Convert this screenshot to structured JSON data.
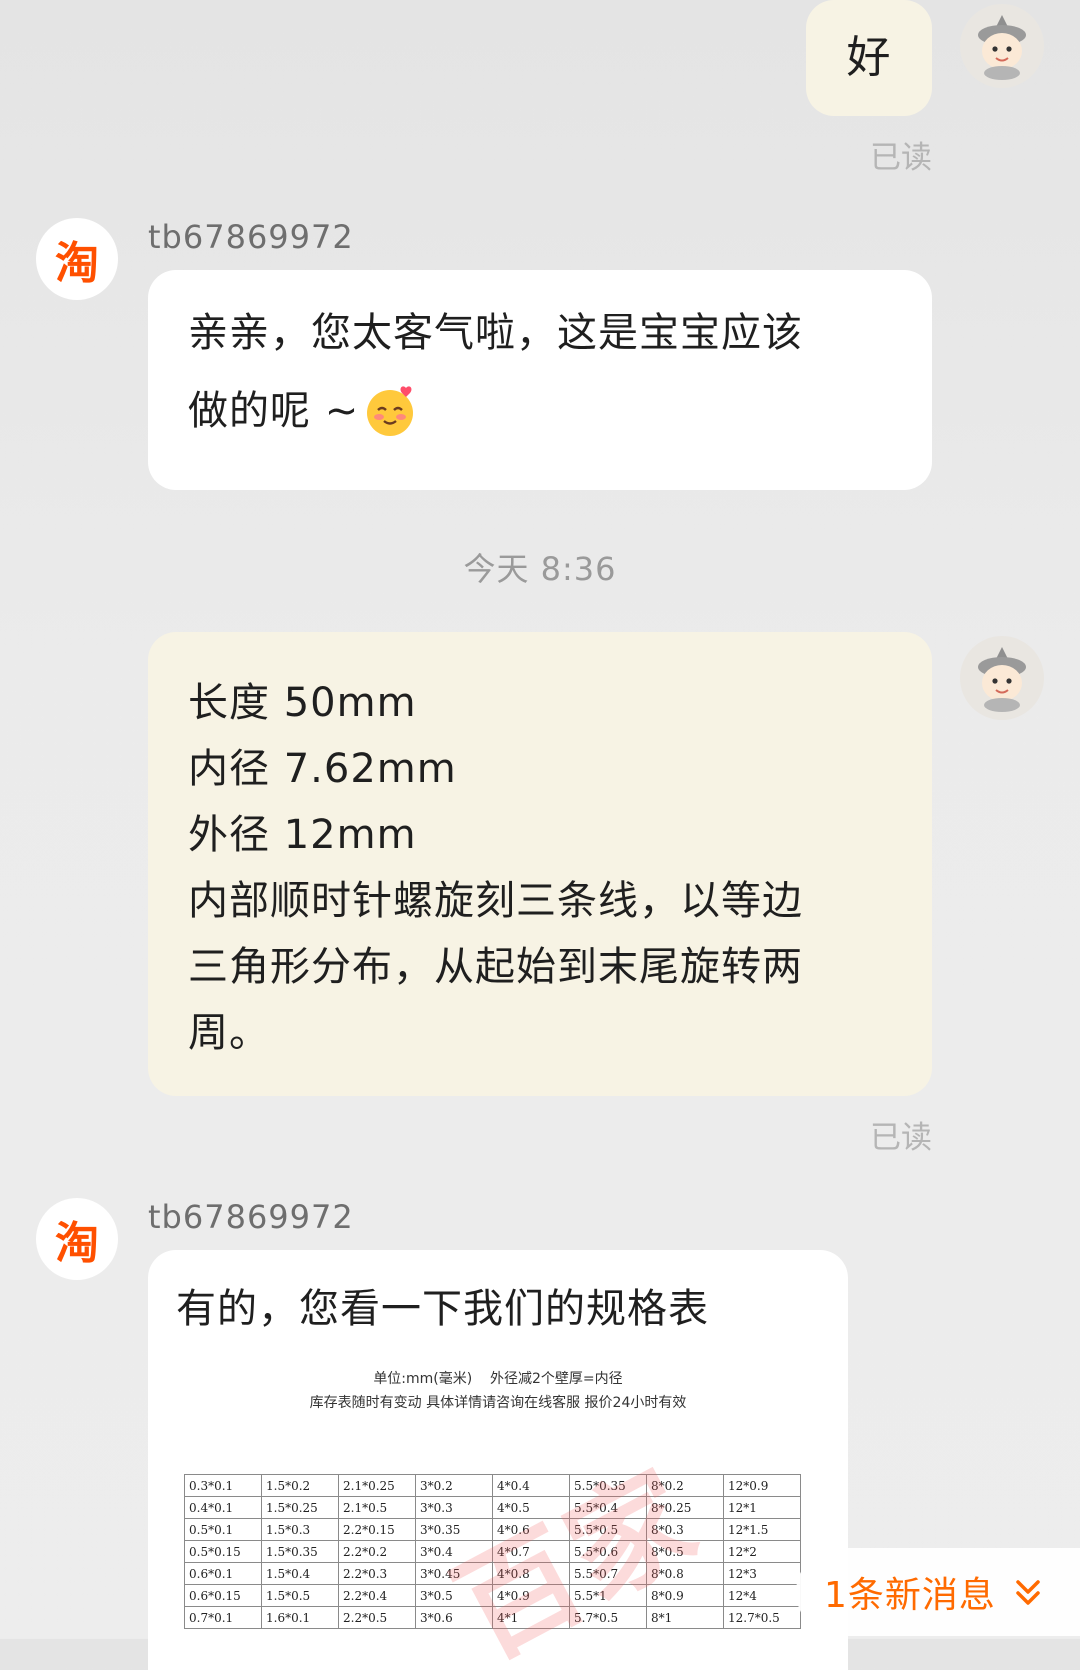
{
  "messages": {
    "m1": {
      "text": "好",
      "status": "已读"
    },
    "m2": {
      "sender": "tb67869972",
      "avatar_char": "淘",
      "line1": "亲亲，您太客气啦，这是宝宝应该",
      "line2": "做的呢 ~"
    },
    "timestamp": "今天 8:36",
    "m3": {
      "lines": [
        "长度 50mm",
        "内径 7.62mm",
        "外径 12mm",
        "内部顺时针螺旋刻三条线，以等边",
        "三角形分布，从起始到末尾旋转两",
        "周。"
      ],
      "status": "已读"
    },
    "m4": {
      "sender": "tb67869972",
      "avatar_char": "淘",
      "text": "有的，您看一下我们的规格表",
      "spec_header1": "单位:mm(毫米)    外径减2个壁厚=内径",
      "spec_header2": "库存表随时有变动 具体详情请咨询在线客服 报价24小时有效",
      "table_rows": [
        [
          "0.3*0.1",
          "1.5*0.2",
          "2.1*0.25",
          "3*0.2",
          "4*0.4",
          "5.5*0.35",
          "8*0.2",
          "12*0.9"
        ],
        [
          "0.4*0.1",
          "1.5*0.25",
          "2.1*0.5",
          "3*0.3",
          "4*0.5",
          "5.5*0.4",
          "8*0.25",
          "12*1"
        ],
        [
          "0.5*0.1",
          "1.5*0.3",
          "2.2*0.15",
          "3*0.35",
          "4*0.6",
          "5.5*0.5",
          "8*0.3",
          "12*1.5"
        ],
        [
          "0.5*0.15",
          "1.5*0.35",
          "2.2*0.2",
          "3*0.4",
          "4*0.7",
          "5.5*0.6",
          "8*0.5",
          "12*2"
        ],
        [
          "0.6*0.1",
          "1.5*0.4",
          "2.2*0.3",
          "3*0.45",
          "4*0.8",
          "5.5*0.7",
          "8*0.8",
          "12*3"
        ],
        [
          "0.6*0.15",
          "1.5*0.5",
          "2.2*0.4",
          "3*0.5",
          "4*0.9",
          "5.5*1",
          "8*0.9",
          "12*4"
        ],
        [
          "0.7*0.1",
          "1.6*0.1",
          "2.2*0.5",
          "3*0.6",
          "4*1",
          "5.7*0.5",
          "8*1",
          "12.7*0.5"
        ]
      ]
    }
  },
  "new_message_banner": {
    "label": "1条新消息",
    "icon": "double-chevron-down-icon"
  },
  "colors": {
    "accent": "#ff6a00",
    "taobao": "#ff5000",
    "my_bubble": "#f7f3e4"
  }
}
